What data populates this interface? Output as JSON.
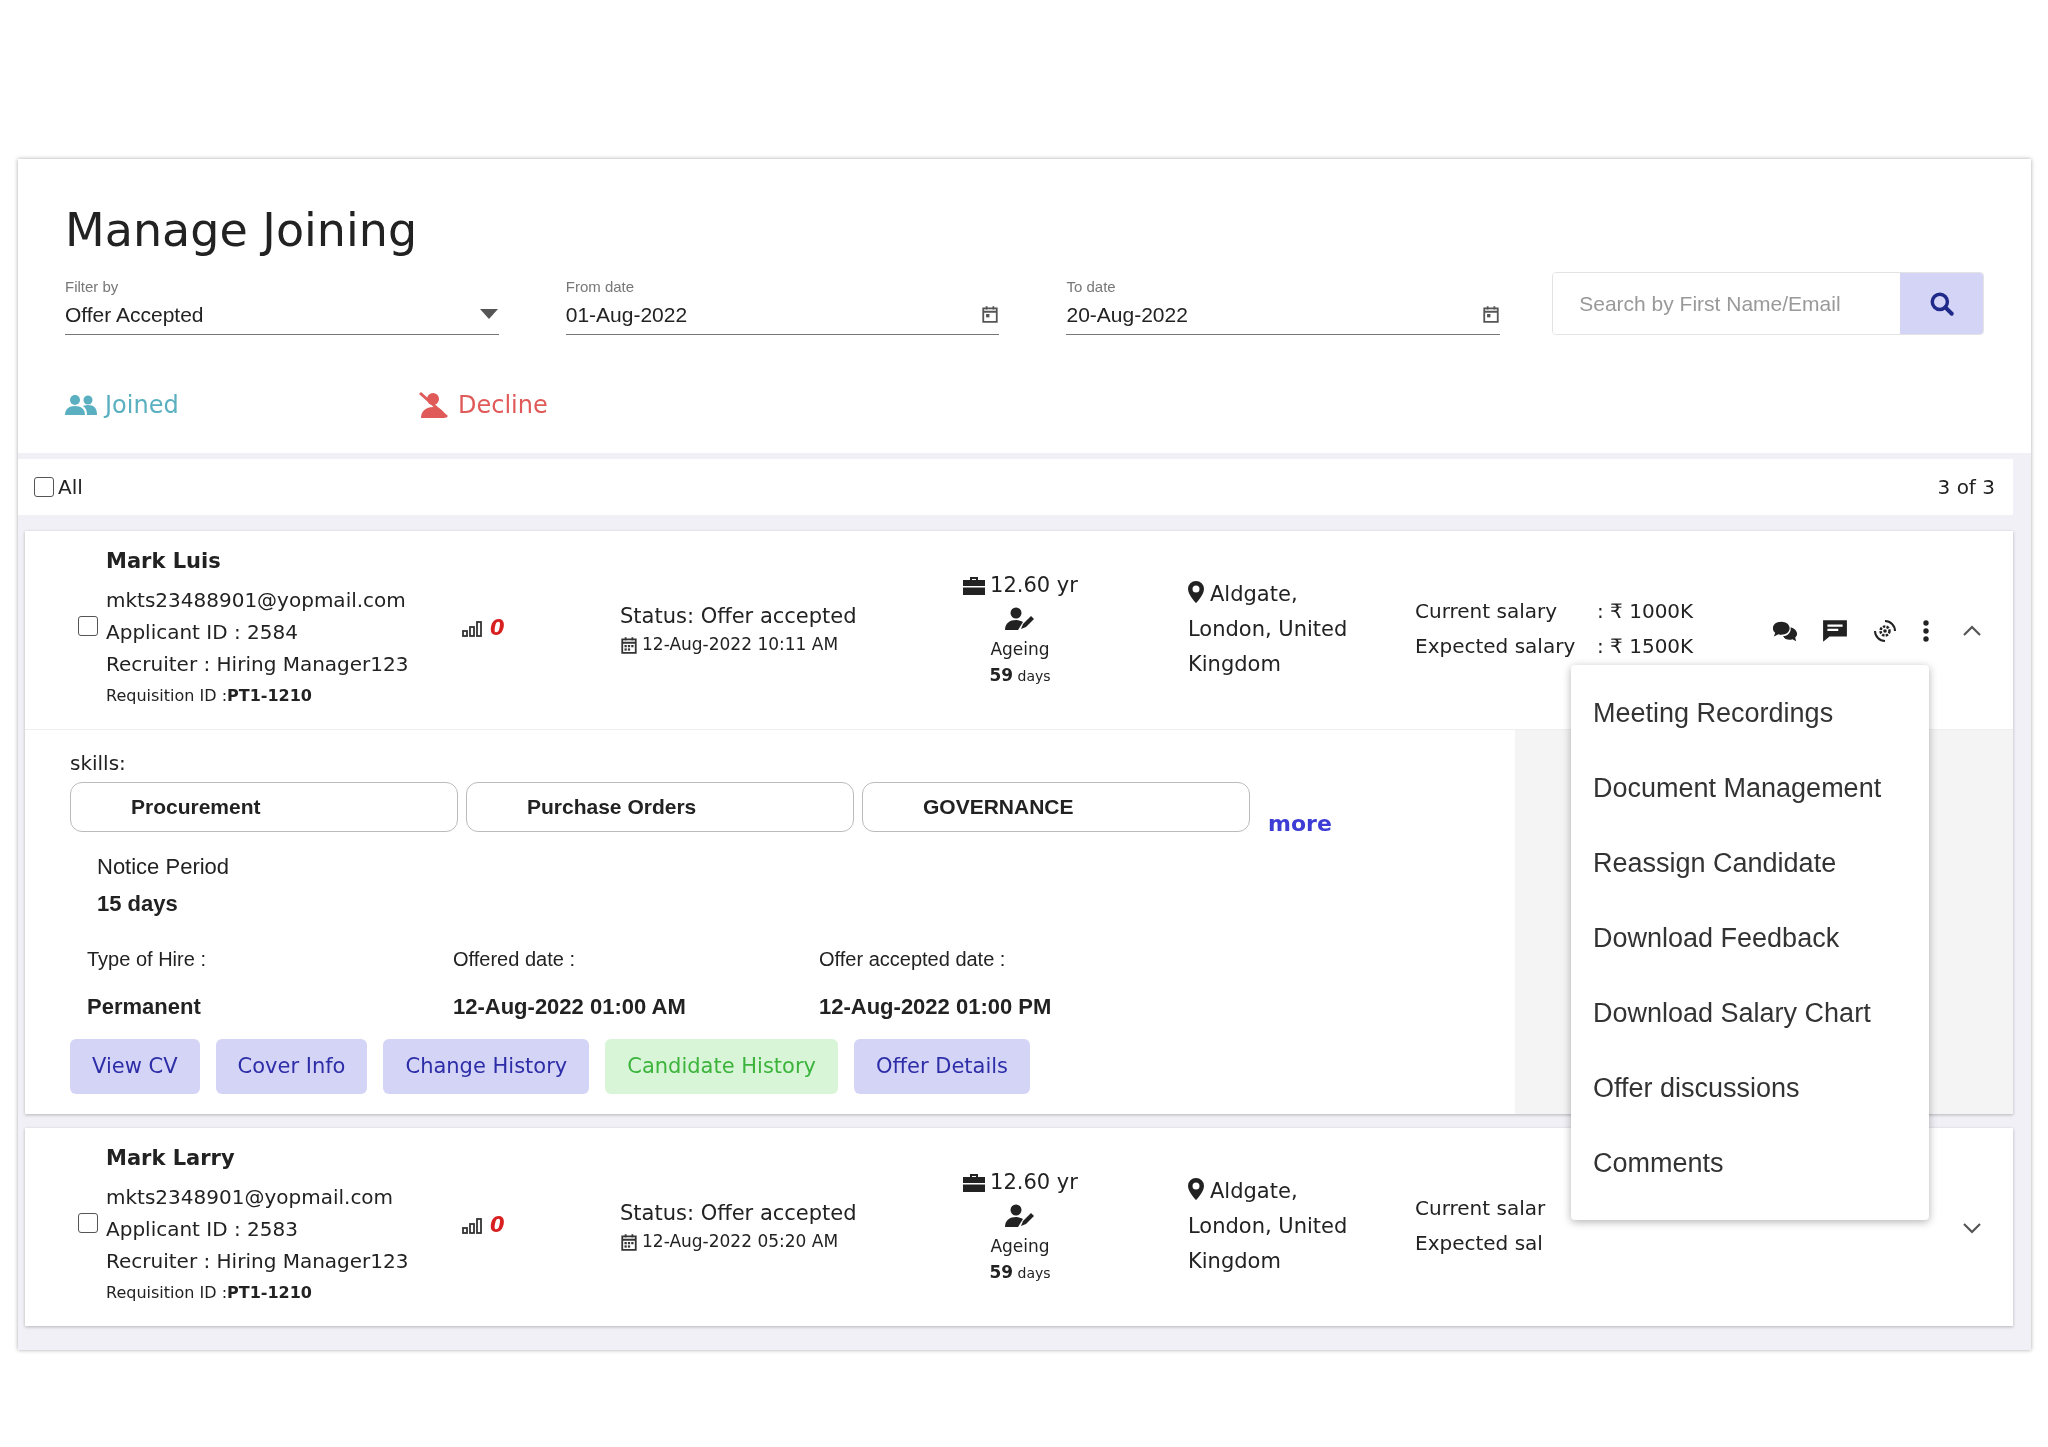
{
  "title": "Manage Joining",
  "filters": [
    {
      "kind": "select",
      "label": "Filter by",
      "value": "Offer Accepted"
    },
    {
      "kind": "date",
      "label": "From date",
      "value": "01-Aug-2022"
    },
    {
      "kind": "date",
      "label": "To date",
      "value": "20-Aug-2022"
    }
  ],
  "search": {
    "placeholder": "Search by First Name/Email"
  },
  "status_actions": [
    {
      "label": "Joined",
      "kind": "joined"
    },
    {
      "label": "Decline",
      "kind": "decline"
    }
  ],
  "select_all": {
    "label": "All",
    "checked": false
  },
  "count": "3 of 3",
  "candidates": [
    {
      "checked": false,
      "expanded": true,
      "show_actions": true,
      "name": "Mark Luis",
      "email": "mkts23488901@yopmail.com",
      "applicant_id": "Applicant ID : 2584",
      "recruiter": "Recruiter : Hiring Manager123",
      "requisition": "Requisition ID :**PT1-1210**",
      "score": "0",
      "status": "Status: Offer accepted",
      "status_date": "12-Aug-2022 10:11 AM",
      "experience": "12.60 yr",
      "ageing_label": "Ageing",
      "ageing": "**59** days",
      "location": "Aldgate, London, United Kingdom",
      "salary": [
        {
          "label": "Current salary",
          "value": ": ₹ 1000K"
        },
        {
          "label": "Expected salary",
          "value": ": ₹ 1500K"
        }
      ],
      "details": {
        "skills_label": "skills:",
        "skills": [
          "Procurement",
          "Purchase Orders",
          "GOVERNANCE"
        ],
        "more": "more",
        "notice_label": "Notice Period",
        "notice_value": "15 days",
        "facts": [
          {
            "label": "Type of Hire :",
            "value": "Permanent"
          },
          {
            "label": "Offered date :",
            "value": "12-Aug-2022 01:00 AM"
          },
          {
            "label": "Offer accepted date :",
            "value": "12-Aug-2022 01:00 PM"
          }
        ],
        "buttons": [
          {
            "label": "View CV",
            "kind": "primary"
          },
          {
            "label": "Cover Info",
            "kind": "primary"
          },
          {
            "label": "Change History",
            "kind": "primary"
          },
          {
            "label": "Candidate History",
            "kind": "success"
          },
          {
            "label": "Offer Details",
            "kind": "primary"
          }
        ]
      },
      "menu": {
        "open": true,
        "items": [
          "Meeting Recordings",
          "Document Management",
          "Reassign Candidate",
          "Download Feedback",
          "Download Salary Chart",
          "Offer discussions",
          "Comments"
        ]
      }
    },
    {
      "checked": false,
      "expanded": false,
      "show_actions": false,
      "name": "Mark Larry",
      "email": "mkts2348901@yopmail.com",
      "applicant_id": "Applicant ID : 2583",
      "recruiter": "Recruiter : Hiring Manager123",
      "requisition": "Requisition ID :**PT1-1210**",
      "score": "0",
      "status": "Status: Offer accepted",
      "status_date": "12-Aug-2022 05:20 AM",
      "experience": "12.60 yr",
      "ageing_label": "Ageing",
      "ageing": "**59** days",
      "location": "Aldgate, London, United Kingdom",
      "salary": [
        {
          "label": "Current salar"
        },
        {
          "label": "Expected sal"
        }
      ]
    }
  ]
}
